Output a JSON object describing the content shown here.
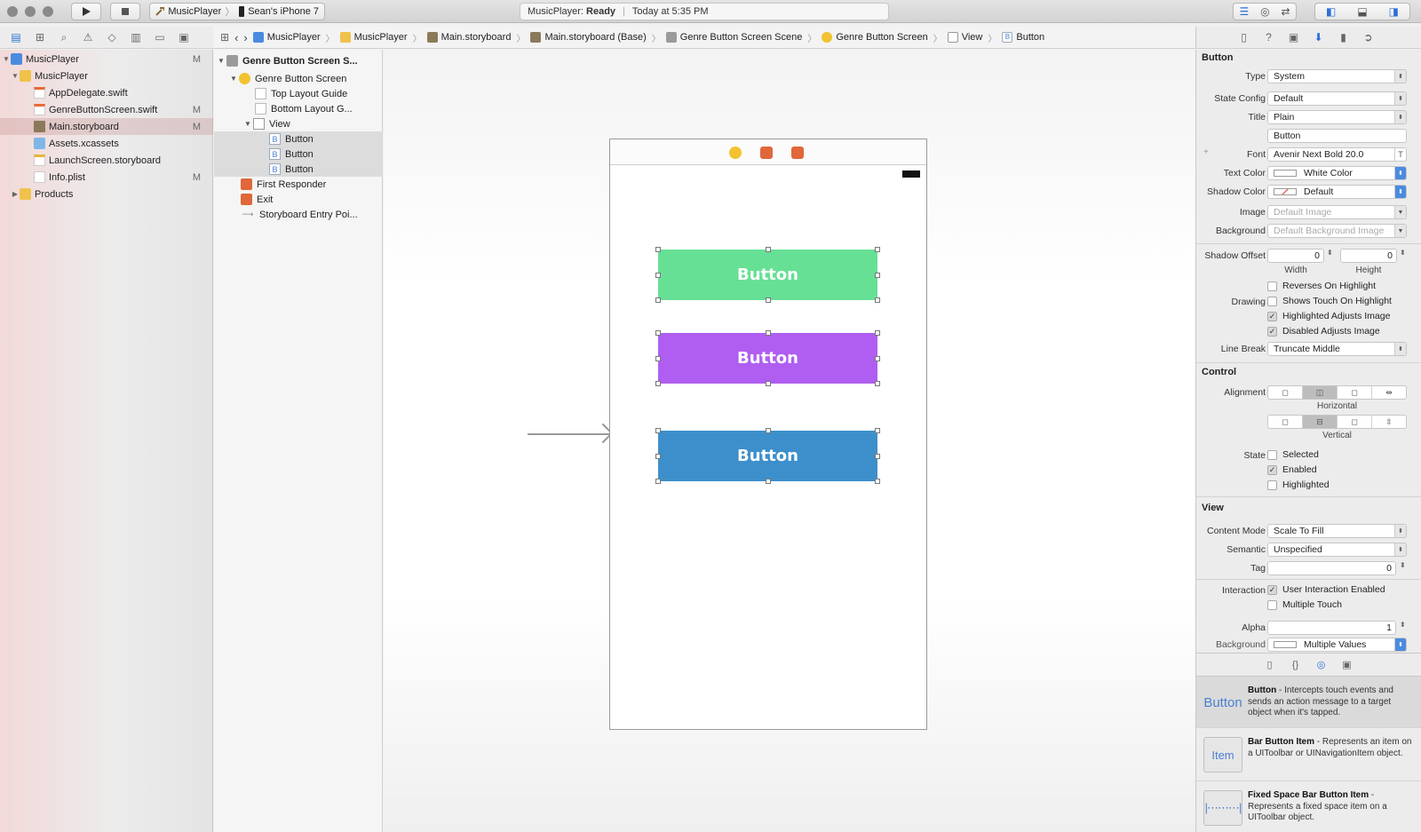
{
  "window": {
    "scheme_app": "MusicPlayer",
    "scheme_device": "Sean's iPhone 7",
    "status_app": "MusicPlayer:",
    "status_state": "Ready",
    "status_time": "Today at 5:35 PM"
  },
  "jumpbar": {
    "items": [
      "MusicPlayer",
      "MusicPlayer",
      "Main.storyboard",
      "Main.storyboard (Base)",
      "Genre Button Screen Scene",
      "Genre Button Screen",
      "View",
      "Button"
    ]
  },
  "navigator": {
    "rows": [
      {
        "label": "MusicPlayer",
        "badge": "M"
      },
      {
        "label": "MusicPlayer",
        "badge": ""
      },
      {
        "label": "AppDelegate.swift",
        "badge": ""
      },
      {
        "label": "GenreButtonScreen.swift",
        "badge": "M"
      },
      {
        "label": "Main.storyboard",
        "badge": "M"
      },
      {
        "label": "Assets.xcassets",
        "badge": ""
      },
      {
        "label": "LaunchScreen.storyboard",
        "badge": ""
      },
      {
        "label": "Info.plist",
        "badge": "M"
      },
      {
        "label": "Products",
        "badge": ""
      }
    ]
  },
  "outline": {
    "rows": [
      "Genre Button Screen S...",
      "Genre Button Screen",
      "Top Layout Guide",
      "Bottom Layout G...",
      "View",
      "Button",
      "Button",
      "Button",
      "First Responder",
      "Exit",
      "Storyboard Entry Poi..."
    ],
    "button_glyph": "B"
  },
  "canvas": {
    "buttons": [
      {
        "label": "Button",
        "color": "#66e095"
      },
      {
        "label": "Button",
        "color": "#b05ef2"
      },
      {
        "label": "Button",
        "color": "#3d8fcb"
      }
    ]
  },
  "inspector": {
    "button_section": "Button",
    "type_label": "Type",
    "type_value": "System",
    "state_config_label": "State Config",
    "state_config_value": "Default",
    "title_label": "Title",
    "title_value": "Plain",
    "title_text": "Button",
    "font_label": "Font",
    "font_value": "Avenir Next Bold 20.0",
    "text_color_label": "Text Color",
    "text_color_value": "White Color",
    "shadow_color_label": "Shadow Color",
    "shadow_color_value": "Default",
    "image_label": "Image",
    "image_placeholder": "Default Image",
    "background_label": "Background",
    "background_placeholder": "Default Background Image",
    "shadow_offset_label": "Shadow Offset",
    "shadow_width": "0",
    "shadow_height": "0",
    "width_label": "Width",
    "height_label": "Height",
    "drawing_label": "Drawing",
    "drawing_options": [
      {
        "label": "Reverses On Highlight",
        "checked": false
      },
      {
        "label": "Shows Touch On Highlight",
        "checked": false
      },
      {
        "label": "Highlighted Adjusts Image",
        "checked": true
      },
      {
        "label": "Disabled Adjusts Image",
        "checked": true
      }
    ],
    "line_break_label": "Line Break",
    "line_break_value": "Truncate Middle",
    "control_section": "Control",
    "alignment_label": "Alignment",
    "horizontal_label": "Horizontal",
    "vertical_label": "Vertical",
    "state_label": "State",
    "state_options": [
      {
        "label": "Selected",
        "checked": false
      },
      {
        "label": "Enabled",
        "checked": true
      },
      {
        "label": "Highlighted",
        "checked": false
      }
    ],
    "view_section": "View",
    "content_mode_label": "Content Mode",
    "content_mode_value": "Scale To Fill",
    "semantic_label": "Semantic",
    "semantic_value": "Unspecified",
    "tag_label": "Tag",
    "tag_value": "0",
    "interaction_label": "Interaction",
    "interaction_options": [
      {
        "label": "User Interaction Enabled",
        "checked": true
      },
      {
        "label": "Multiple Touch",
        "checked": false
      }
    ],
    "alpha_label": "Alpha",
    "alpha_value": "1",
    "cutoff_label": "Background",
    "cutoff_value": "Multiple Values"
  },
  "library": {
    "items": [
      {
        "thumb": "Button",
        "title": "Button",
        "desc": " - Intercepts touch events and sends an action message to a target object when it's tapped."
      },
      {
        "thumb": "Item",
        "title": "Bar Button Item",
        "desc": " - Represents an item on a UIToolbar or UINavigationItem object."
      },
      {
        "thumb": "",
        "title": "Fixed Space Bar Button Item",
        "desc": " - Represents a fixed space item on a UIToolbar object."
      }
    ]
  },
  "colors": {
    "accent": "#2d6fd6",
    "storyboard_icon": "#8a7a5a",
    "folder": "#f0c24b"
  }
}
